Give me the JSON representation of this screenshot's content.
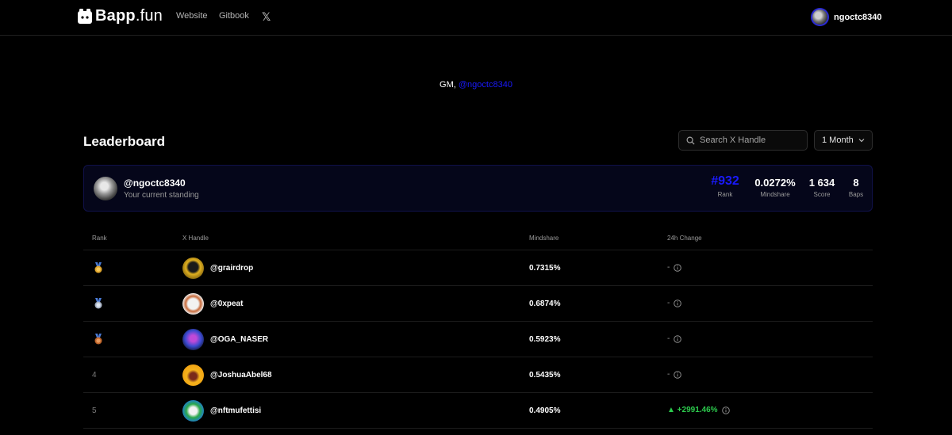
{
  "brand": {
    "bold": "Bapp",
    "rest": ".fun"
  },
  "nav": {
    "website": "Website",
    "gitbook": "Gitbook",
    "x": "𝕏"
  },
  "user": {
    "name": "ngoctc8340"
  },
  "greeting": {
    "prefix": "GM, ",
    "handle": "@ngoctc8340"
  },
  "leaderboard": {
    "title": "Leaderboard",
    "search_placeholder": "Search X Handle",
    "period": "1 Month",
    "standing": {
      "handle": "@ngoctc8340",
      "subtitle": "Your current standing",
      "rank": "#932",
      "rank_label": "Rank",
      "mindshare": "0.0272%",
      "mindshare_label": "Mindshare",
      "score": "1 634",
      "score_label": "Score",
      "baps": "8",
      "baps_label": "Baps"
    },
    "columns": {
      "rank": "Rank",
      "handle": "X Handle",
      "mindshare": "Mindshare",
      "change": "24h Change"
    },
    "rows": [
      {
        "rank": "1",
        "handle": "@grairdrop",
        "mindshare": "0.7315%",
        "change": "-"
      },
      {
        "rank": "2",
        "handle": "@0xpeat",
        "mindshare": "0.6874%",
        "change": "-"
      },
      {
        "rank": "3",
        "handle": "@OGA_NASER",
        "mindshare": "0.5923%",
        "change": "-"
      },
      {
        "rank": "4",
        "handle": "@JoshuaAbel68",
        "mindshare": "0.5435%",
        "change": "-"
      },
      {
        "rank": "5",
        "handle": "@nftmufettisi",
        "mindshare": "0.4905%",
        "change": "▲ +2991.46%"
      }
    ]
  },
  "colors": {
    "accent": "#1a1aff",
    "positive": "#2ccb4d",
    "gold": "#e0a52a",
    "silver": "#c9d2e0",
    "bronze": "#d2783a"
  }
}
